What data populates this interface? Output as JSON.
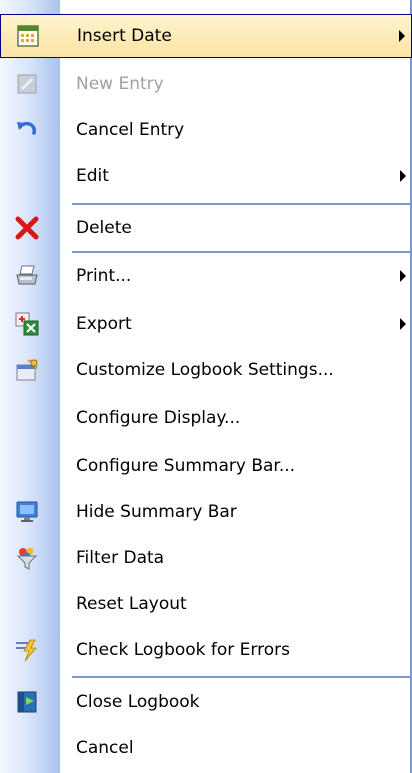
{
  "menu": {
    "items": [
      {
        "label": "Insert Date",
        "icon": "calendar-icon",
        "submenu": true
      },
      {
        "label": "New Entry",
        "icon": "new-entry-icon",
        "disabled": true
      },
      {
        "label": "Cancel Entry",
        "icon": "undo-icon"
      },
      {
        "label": "Edit",
        "submenu": true
      },
      {
        "label": "Delete",
        "icon": "delete-x-icon"
      },
      {
        "label": "Print...",
        "icon": "printer-icon",
        "submenu": true
      },
      {
        "label": "Export",
        "icon": "export-icon",
        "submenu": true
      },
      {
        "label": "Customize Logbook Settings...",
        "icon": "settings-icon"
      },
      {
        "label": "Configure Display..."
      },
      {
        "label": "Configure Summary Bar..."
      },
      {
        "label": "Hide Summary Bar",
        "icon": "monitor-icon"
      },
      {
        "label": "Filter Data",
        "icon": "filter-icon"
      },
      {
        "label": "Reset Layout"
      },
      {
        "label": "Check Logbook for Errors",
        "icon": "check-errors-icon"
      },
      {
        "label": "Close Logbook",
        "icon": "close-logbook-icon"
      },
      {
        "label": "Cancel"
      }
    ]
  },
  "colors": {
    "highlight_border": "#000080",
    "separator": "#7a96d7",
    "disabled_text": "#a0a0a0",
    "delete_red": "#d81818"
  }
}
